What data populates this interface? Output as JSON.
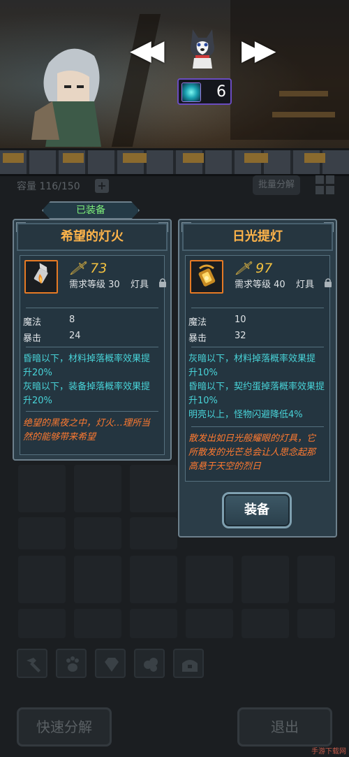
{
  "scene": {
    "pet_count": "6",
    "nav": {
      "prev_icon": "rewind-icon",
      "next_icon": "fast-forward-icon"
    }
  },
  "inventory": {
    "capacity_label": "容量 116/150",
    "batch_label": "批量分解"
  },
  "equipped_tag": "已装备",
  "cards": [
    {
      "title": "希望的灯火",
      "damage": "73",
      "req_level": "需求等级 30",
      "type": "灯具",
      "stats": [
        {
          "label": "魔法",
          "value": "8"
        },
        {
          "label": "暴击",
          "value": "24"
        }
      ],
      "effects": [
        "昏暗以下，材料掉落概率效果提",
        "升20%",
        "灰暗以下，装备掉落概率效果提",
        "升20%"
      ],
      "lore": [
        "绝望的黑夜之中，灯火…理所当",
        "然的能够带来希望"
      ]
    },
    {
      "title": "日光提灯",
      "damage": "97",
      "req_level": "需求等级 40",
      "type": "灯具",
      "stats": [
        {
          "label": "魔法",
          "value": "10"
        },
        {
          "label": "暴击",
          "value": "32"
        }
      ],
      "effects": [
        "灰暗以下，材料掉落概率效果提",
        "升10%",
        "昏暗以下，契约蛋掉落概率效果提",
        "升10%",
        "明亮以上，怪物闪避降低4%"
      ],
      "lore": [
        "散发出如日光般耀眼的灯具，它",
        "所散发的光芒总会让人思念起那",
        "高悬于天空的烈日"
      ],
      "equip_label": "装备"
    }
  ],
  "bottom": {
    "quick_decompose": "快速分解",
    "exit": "退出"
  },
  "watermark": "手游下载网"
}
